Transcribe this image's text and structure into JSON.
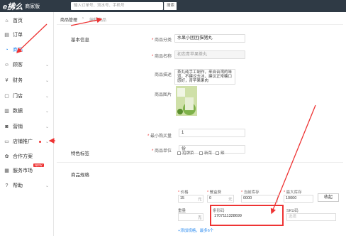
{
  "topbar": {
    "logo": "e拂么",
    "logo_tag": "商家版",
    "search_placeholder": "输入订单号、流水号、手机号",
    "search_button": "搜索"
  },
  "sidebar": {
    "items": [
      {
        "label": "首页",
        "icon": "home-icon"
      },
      {
        "label": "订单",
        "icon": "order-icon"
      },
      {
        "label": "商品",
        "icon": "product-icon",
        "active": true
      },
      {
        "label": "顾客",
        "icon": "customer-icon"
      },
      {
        "label": "财务",
        "icon": "finance-icon"
      },
      {
        "label": "门店",
        "icon": "store-icon"
      },
      {
        "label": "数据",
        "icon": "data-icon"
      },
      {
        "label": "营销",
        "icon": "marketing-icon"
      },
      {
        "label": "店铺推广",
        "icon": "promotion-icon"
      },
      {
        "label": "合作方案",
        "icon": "cooperation-icon"
      },
      {
        "label": "服务市场",
        "icon": "market-icon",
        "badge": "NEW"
      },
      {
        "label": "帮助",
        "icon": "help-icon"
      }
    ]
  },
  "breadcrumb": {
    "first": "商品管理",
    "sep": "›",
    "current": "编辑商品"
  },
  "basic": {
    "section_title": "基本信息",
    "category_label": "商品分类",
    "category_value": "水果小团团|猫猪丸",
    "name_label": "商品名称",
    "name_value": "初恋青苹果茶丸",
    "desc_label": "商品描述",
    "desc_value": "茶丸纯手工制作，来自台湾的味道，不建议去冰，建议正常糖口感好，青苹果果肉",
    "image_label": "商品图片",
    "min_qty_label": "最小购买量",
    "min_qty_value": "1",
    "unit_label": "商品单位",
    "unit_value": "份"
  },
  "tags": {
    "section_title": "特色标签",
    "options": [
      "招牌菜",
      "新菜",
      "辣"
    ]
  },
  "spec": {
    "section_title": "商品规格",
    "headers": {
      "price": "价格",
      "box_fee": "餐盒费",
      "stock": "当前库存",
      "max_stock": "最大库存"
    },
    "price": "15",
    "price_unit": "元",
    "box_fee": "0",
    "box_unit": "元",
    "stock": "0000",
    "max_stock": "10000",
    "save_button": "收起",
    "weight_label": "重量",
    "weight_unit": "克",
    "barcode_label": "条形码",
    "barcode_value": "1707111328699",
    "sku_label": "SKU码",
    "sku_placeholder": "选填",
    "add_link": "+添加规格，最多6个"
  }
}
